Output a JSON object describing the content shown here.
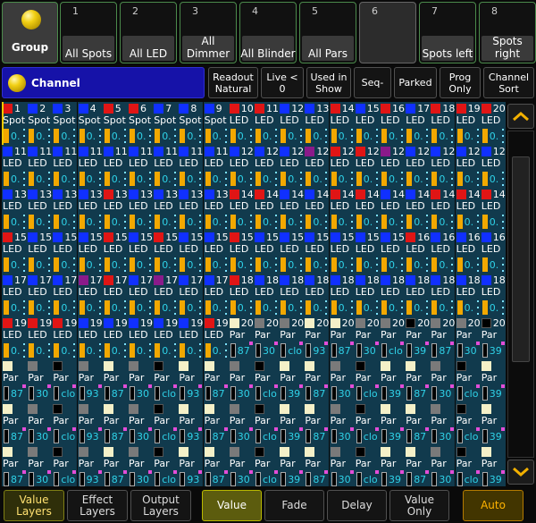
{
  "group": {
    "master_label": "Group",
    "buttons": [
      {
        "num": "1",
        "label": "All Spots",
        "filled": true
      },
      {
        "num": "2",
        "label": "All LED",
        "filled": true
      },
      {
        "num": "3",
        "label": "All Dimmer",
        "filled": true
      },
      {
        "num": "4",
        "label": "All Blinder",
        "filled": true
      },
      {
        "num": "5",
        "label": "All Pars",
        "filled": true
      },
      {
        "num": "6",
        "label": "",
        "filled": false
      },
      {
        "num": "7",
        "label": "Spots left",
        "filled": true
      },
      {
        "num": "8",
        "label": "Spots\nright",
        "filled": true
      }
    ]
  },
  "toolbar": {
    "title": "Channel",
    "buttons": [
      {
        "label": "Readout\nNatural"
      },
      {
        "label": "Live <\n0"
      },
      {
        "label": "Used in\nShow"
      },
      {
        "label": "Seq-"
      },
      {
        "label": "Parked"
      },
      {
        "label": "Prog\nOnly"
      },
      {
        "label": "Channel\nSort"
      }
    ]
  },
  "grid": {
    "rows": [
      {
        "type": "Spot",
        "ids": [
          "1",
          "2",
          "3",
          "4",
          "5",
          "6",
          "7",
          "8",
          "9",
          "10",
          "11",
          "12",
          "13",
          "14",
          "15",
          "16",
          "17",
          "18",
          "19",
          "20"
        ],
        "names": [
          "Spot",
          "Spot",
          "Spot",
          "Spot",
          "Spot",
          "Spot",
          "Spot",
          "Spot",
          "Spot",
          "LED",
          "LED",
          "LED",
          "LED",
          "LED",
          "LED",
          "LED",
          "LED",
          "LED",
          "LED",
          "LED"
        ],
        "vals": [
          "0.",
          "0.",
          "0.",
          "0.",
          "0.",
          "0.",
          "0.",
          "0.",
          "0.",
          "0.",
          "0.",
          "0.",
          "0.",
          "0.",
          "0.",
          "0.",
          "0.",
          "0.",
          "0.",
          "0."
        ],
        "colors": [
          "red",
          "blue",
          "blue",
          "blue",
          "red",
          "red",
          "blue",
          "blue",
          "blue",
          "red",
          "red",
          "blue",
          "blue",
          "red",
          "blue",
          "red",
          "blue",
          "red",
          "red",
          "red"
        ]
      },
      {
        "type": "LED",
        "ids": [
          "11",
          "11",
          "11",
          "11",
          "11",
          "11",
          "11",
          "11",
          "11",
          "12",
          "12",
          "12",
          "12",
          "12",
          "12",
          "12",
          "12",
          "12",
          "12",
          "12"
        ],
        "names": [
          "LED",
          "LED",
          "LED",
          "LED",
          "LED",
          "LED",
          "LED",
          "LED",
          "LED",
          "LED",
          "LED",
          "LED",
          "LED",
          "LED",
          "LED",
          "LED",
          "LED",
          "LED",
          "LED",
          "LED"
        ],
        "vals": [
          "0.",
          "0.",
          "0.",
          "0.",
          "0.",
          "0.",
          "0.",
          "0.",
          "0.",
          "0.",
          "0.",
          "0.",
          "0.",
          "0.",
          "0.",
          "0.",
          "0.",
          "0.",
          "0.",
          "0."
        ],
        "colors": [
          "blue",
          "blue",
          "blue",
          "blue",
          "blue",
          "blue",
          "blue",
          "blue",
          "blue",
          "blue",
          "blue",
          "blue",
          "purple",
          "red",
          "red",
          "purple",
          "blue",
          "blue",
          "blue",
          "blue"
        ]
      },
      {
        "type": "LED",
        "ids": [
          "13",
          "13",
          "13",
          "13",
          "13",
          "13",
          "13",
          "13",
          "13",
          "14",
          "14",
          "14",
          "14",
          "14",
          "14",
          "14",
          "14",
          "14",
          "14",
          "14"
        ],
        "names": [
          "LED",
          "LED",
          "LED",
          "LED",
          "LED",
          "LED",
          "LED",
          "LED",
          "LED",
          "LED",
          "LED",
          "LED",
          "LED",
          "LED",
          "LED",
          "LED",
          "LED",
          "LED",
          "LED",
          "LED"
        ],
        "vals": [
          "0.",
          "0.",
          "0.",
          "0.",
          "0.",
          "0.",
          "0.",
          "0.",
          "0.",
          "0.",
          "0.",
          "0.",
          "0.",
          "0.",
          "0.",
          "0.",
          "0.",
          "0.",
          "0.",
          "0."
        ],
        "colors": [
          "blue",
          "blue",
          "blue",
          "blue",
          "red",
          "blue",
          "blue",
          "blue",
          "blue",
          "red",
          "red",
          "blue",
          "blue",
          "red",
          "red",
          "blue",
          "blue",
          "red",
          "red",
          "red"
        ]
      },
      {
        "type": "LED",
        "ids": [
          "15",
          "15",
          "15",
          "15",
          "15",
          "15",
          "15",
          "15",
          "15",
          "15",
          "15",
          "15",
          "15",
          "15",
          "15",
          "15",
          "16",
          "16",
          "16",
          "16"
        ],
        "names": [
          "LED",
          "LED",
          "LED",
          "LED",
          "LED",
          "LED",
          "LED",
          "LED",
          "LED",
          "LED",
          "LED",
          "LED",
          "LED",
          "LED",
          "LED",
          "LED",
          "LED",
          "LED",
          "LED",
          "LED"
        ],
        "vals": [
          "0.",
          "0.",
          "0.",
          "0.",
          "0.",
          "0.",
          "0.",
          "0.",
          "0.",
          "0.",
          "0.",
          "0.",
          "0.",
          "0.",
          "0.",
          "0.",
          "0.",
          "0.",
          "0.",
          "0."
        ],
        "colors": [
          "red",
          "blue",
          "blue",
          "blue",
          "red",
          "blue",
          "red",
          "blue",
          "blue",
          "red",
          "blue",
          "blue",
          "blue",
          "blue",
          "blue",
          "blue",
          "red",
          "blue",
          "blue",
          "blue"
        ]
      },
      {
        "type": "LED",
        "ids": [
          "17",
          "17",
          "17",
          "17",
          "17",
          "17",
          "17",
          "17",
          "17",
          "18",
          "18",
          "18",
          "18",
          "18",
          "18",
          "18",
          "18",
          "18",
          "18",
          "18"
        ],
        "names": [
          "LED",
          "LED",
          "LED",
          "LED",
          "LED",
          "LED",
          "LED",
          "LED",
          "LED",
          "LED",
          "LED",
          "LED",
          "LED",
          "LED",
          "LED",
          "LED",
          "LED",
          "LED",
          "LED",
          "LED"
        ],
        "vals": [
          "0.",
          "0.",
          "0.",
          "0.",
          "0.",
          "0.",
          "0.",
          "0.",
          "0.",
          "0.",
          "0.",
          "0.",
          "0.",
          "0.",
          "0.",
          "0.",
          "0.",
          "0.",
          "0.",
          "0."
        ],
        "colors": [
          "blue",
          "blue",
          "blue",
          "purple",
          "red",
          "blue",
          "purple",
          "blue",
          "blue",
          "red",
          "blue",
          "blue",
          "blue",
          "blue",
          "blue",
          "blue",
          "blue",
          "blue",
          "blue",
          "blue"
        ]
      },
      {
        "type": "LED",
        "ids": [
          "19",
          "19",
          "19",
          "19",
          "19",
          "19",
          "19",
          "19",
          "19",
          "20",
          "20",
          "20",
          "20",
          "20",
          "20",
          "20",
          "20",
          "20",
          "20",
          "20"
        ],
        "names": [
          "LED",
          "LED",
          "LED",
          "LED",
          "LED",
          "LED",
          "LED",
          "LED",
          "LED",
          "Par",
          "Par",
          "Par",
          "Par",
          "Par",
          "Par",
          "Par",
          "Par",
          "Par",
          "Par",
          "Par"
        ],
        "vals": [
          "0.",
          "0.",
          "0.",
          "0.",
          "0.",
          "0.",
          "0.",
          "0.",
          "0.",
          "87",
          "30",
          "clo",
          "93",
          "87",
          "30",
          "clo",
          "39",
          "87",
          "30",
          "39"
        ],
        "colors": [
          "red",
          "red",
          "red",
          "blue",
          "blue",
          "blue",
          "blue",
          "blue",
          "red",
          "cream",
          "gray",
          "gray",
          "cream",
          "cream",
          "gray",
          "gray",
          "black",
          "gray",
          "gray",
          "black"
        ]
      },
      {
        "type": "Par",
        "ids": [
          "",
          "",
          "",
          "",
          "",
          "",
          "",
          "",
          "",
          "",
          "",
          "",
          "",
          "",
          "",
          "",
          "",
          "",
          "",
          ""
        ],
        "names": [
          "Par",
          "Par",
          "Par",
          "Par",
          "Par",
          "Par",
          "Par",
          "Par",
          "Par",
          "Par",
          "Par",
          "Par",
          "Par",
          "Par",
          "Par",
          "Par",
          "Par",
          "Par",
          "Par",
          "Par"
        ],
        "vals": [
          "87",
          "30",
          "clo",
          "93",
          "87",
          "30",
          "clo",
          "93",
          "87",
          "30",
          "clo",
          "39",
          "87",
          "30",
          "clo",
          "39",
          "87",
          "30",
          "clo",
          "39"
        ],
        "colors": [
          "cream",
          "gray",
          "black",
          "gray",
          "cream",
          "gray",
          "black",
          "cream",
          "cream",
          "gray",
          "black",
          "cream",
          "cream",
          "gray",
          "black",
          "cream",
          "cream",
          "gray",
          "black",
          "cream"
        ]
      },
      {
        "type": "Par",
        "ids": [
          "",
          "",
          "",
          "",
          "",
          "",
          "",
          "",
          "",
          "",
          "",
          "",
          "",
          "",
          "",
          "",
          "",
          "",
          "",
          ""
        ],
        "names": [
          "Par",
          "Par",
          "Par",
          "Par",
          "Par",
          "Par",
          "Par",
          "Par",
          "Par",
          "Par",
          "Par",
          "Par",
          "Par",
          "Par",
          "Par",
          "Par",
          "Par",
          "Par",
          "Par",
          "Par"
        ],
        "vals": [
          "87",
          "30",
          "clo",
          "93",
          "87",
          "30",
          "clo",
          "93",
          "87",
          "30",
          "clo",
          "39",
          "87",
          "30",
          "clo",
          "39",
          "87",
          "30",
          "clo",
          "39"
        ],
        "colors": [
          "cream",
          "gray",
          "black",
          "gray",
          "cream",
          "gray",
          "black",
          "cream",
          "cream",
          "gray",
          "black",
          "cream",
          "cream",
          "gray",
          "black",
          "cream",
          "cream",
          "gray",
          "black",
          "cream"
        ]
      },
      {
        "type": "Par",
        "ids": [
          "",
          "",
          "",
          "",
          "",
          "",
          "",
          "",
          "",
          "",
          "",
          "",
          "",
          "",
          "",
          "",
          "",
          "",
          "",
          ""
        ],
        "names": [
          "Par",
          "Par",
          "Par",
          "Par",
          "Par",
          "Par",
          "Par",
          "Par",
          "Par",
          "Par",
          "Par",
          "Par",
          "Par",
          "Par",
          "Par",
          "Par",
          "Par",
          "Par",
          "Par",
          "Par"
        ],
        "vals": [
          "87",
          "30",
          "clo",
          "93",
          "87",
          "30",
          "clo",
          "93",
          "87",
          "30",
          "clo",
          "39",
          "87",
          "30",
          "clo",
          "39",
          "87",
          "30",
          "clo",
          "39"
        ],
        "colors": [
          "cream",
          "gray",
          "black",
          "gray",
          "cream",
          "gray",
          "black",
          "cream",
          "cream",
          "gray",
          "black",
          "cream",
          "cream",
          "gray",
          "black",
          "cream",
          "cream",
          "gray",
          "black",
          "cream"
        ]
      }
    ],
    "palette": {
      "red": "#e01515",
      "blue": "#1030ff",
      "purple": "#8a1a8a",
      "cream": "#f4f0c8",
      "gray": "#7a7a7a",
      "black": "#000000"
    },
    "bar_color": "#f2a800"
  },
  "bottom": {
    "buttons": [
      {
        "label": "Value\nLayers",
        "state": "on"
      },
      {
        "label": "Effect\nLayers",
        "state": ""
      },
      {
        "label": "Output\nLayers",
        "state": ""
      },
      {
        "label": "Value",
        "state": "active"
      },
      {
        "label": "Fade",
        "state": ""
      },
      {
        "label": "Delay",
        "state": ""
      },
      {
        "label": "Value\nOnly",
        "state": ""
      },
      {
        "label": "Auto",
        "state": "auto"
      }
    ]
  }
}
